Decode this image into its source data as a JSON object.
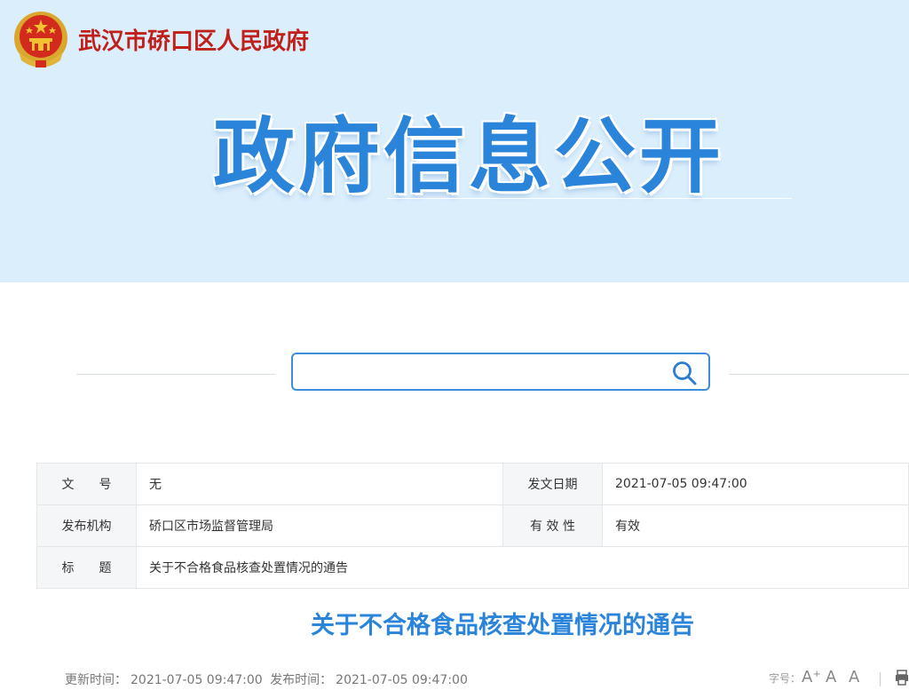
{
  "header": {
    "gov_name": "武汉市硚口区人民政府",
    "banner_title": "政府信息公开",
    "emblem_icon": "national-emblem-icon",
    "colors": {
      "banner_bg": "#dbeefc",
      "title_blue": "#2a84da",
      "gov_red": "#c1201a"
    }
  },
  "search": {
    "placeholder": "",
    "value": "",
    "icon": "search-icon"
  },
  "meta": {
    "rows": [
      {
        "label1": "文　　号",
        "value1": "无",
        "label2": "发文日期",
        "value2": "2021-07-05 09:47:00"
      },
      {
        "label1": "发布机构",
        "value1": "硚口区市场监督管理局",
        "label2": "有 效 性",
        "value2": "有效"
      },
      {
        "label1": "标　　题",
        "value1": "关于不合格食品核查处置情况的通告"
      }
    ]
  },
  "article": {
    "title": "关于不合格食品核查处置情况的通告",
    "updated_label": "更新时间：",
    "updated_value": "2021-07-05 09:47:00",
    "published_label": "发布时间：",
    "published_value": "2021-07-05 09:47:00"
  },
  "font_controls": {
    "label": "字号：",
    "larger": "A⁺",
    "normal": "A",
    "smaller": "A",
    "print_icon": "print-icon"
  }
}
